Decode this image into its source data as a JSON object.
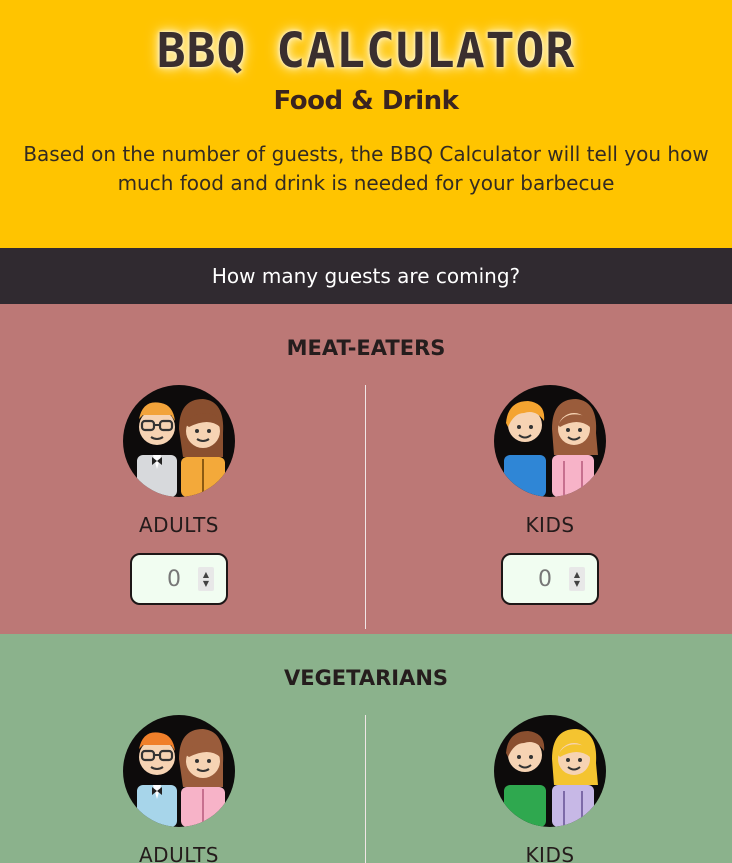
{
  "header": {
    "title": "BBQ CALCULATOR",
    "subtitle": "Food & Drink",
    "intro": "Based on the number of guests, the BBQ Calculator will tell you how much food and drink is needed for your barbecue"
  },
  "question": "How many guests are coming?",
  "groups": {
    "meat": {
      "title": "MEAT-EATERS",
      "adults_label": "ADULTS",
      "adults_value": "0",
      "kids_label": "KIDS",
      "kids_value": "0",
      "color": "#bc7876"
    },
    "veg": {
      "title": "VEGETARIANS",
      "adults_label": "ADULTS",
      "kids_label": "KIDS",
      "color": "#8bb28c"
    }
  },
  "icons": {
    "adults": "adults-couple-icon",
    "kids": "kids-pair-icon",
    "spin_up": "▲",
    "spin_down": "▼"
  },
  "colors": {
    "header_bg": "#ffc400",
    "question_bg": "#302a30",
    "stepper_bg": "#f1fdf1"
  }
}
